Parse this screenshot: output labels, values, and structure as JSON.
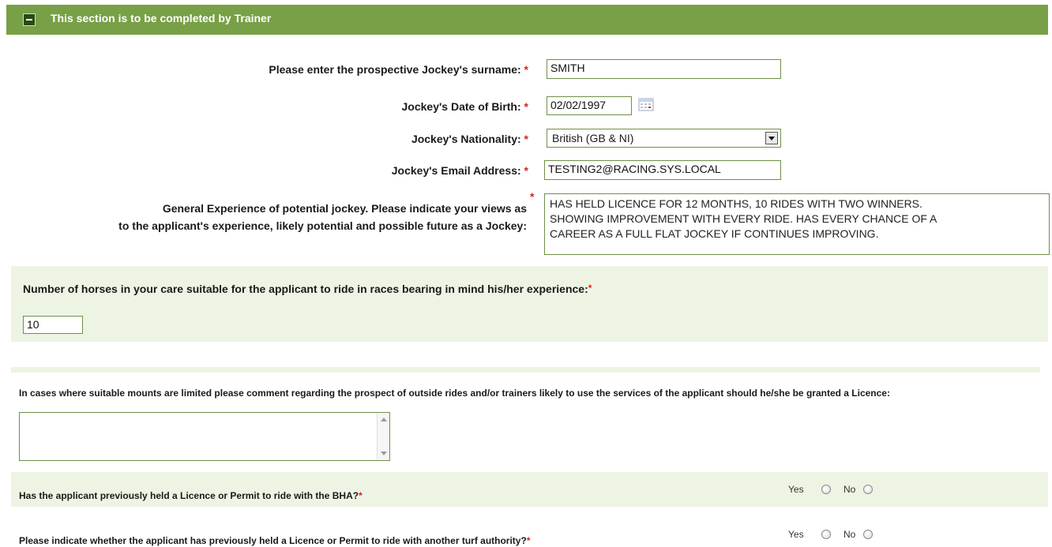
{
  "section": {
    "title": "This section is to be completed by Trainer",
    "collapse_symbol": "−"
  },
  "required_marker": "*",
  "fields": {
    "surname": {
      "label": "Please enter the prospective Jockey's surname:",
      "value": "SMITH"
    },
    "dob": {
      "label": "Jockey's Date of Birth:",
      "value": "02/02/1997"
    },
    "nationality": {
      "label": "Jockey's Nationality:",
      "value": "British (GB & NI)"
    },
    "email": {
      "label": "Jockey's Email Address:",
      "value": "TESTING2@RACING.SYS.LOCAL"
    },
    "experience": {
      "label_line1": "General Experience of potential jockey. Please indicate your views as",
      "label_line2": "to the applicant's experience, likely potential and possible future as a Jockey:",
      "value_line1": "HAS HELD LICENCE FOR 12 MONTHS, 10 RIDES WITH TWO WINNERS.",
      "value_line2": "SHOWING IMPROVEMENT WITH EVERY RIDE.  HAS EVERY CHANCE OF A",
      "value_line3": "CAREER AS A FULL FLAT JOCKEY IF CONTINUES IMPROVING."
    }
  },
  "horses": {
    "label": "Number of horses in your care suitable for the applicant to ride in races bearing in mind his/her experience:",
    "value": "10"
  },
  "outside_rides": {
    "label": "In cases where suitable mounts are limited please comment regarding the prospect of outside rides and/or trainers likely to use the services of the applicant should he/she be granted a Licence:",
    "value": ""
  },
  "questions": [
    {
      "label": "Has the applicant previously held a Licence or Permit to ride with the BHA?",
      "yes": "Yes",
      "no": "No"
    },
    {
      "label": "Please indicate whether the applicant has previously held a Licence or Permit to ride with another turf authority?",
      "yes": "Yes",
      "no": "No"
    }
  ],
  "colors": {
    "header_green": "#78a046",
    "panel_green": "#eef4e4",
    "required_red": "#d9241b"
  },
  "icons": {
    "collapse": "minus-icon",
    "calendar": "calendar-icon",
    "dropdown": "chevron-down-icon"
  }
}
